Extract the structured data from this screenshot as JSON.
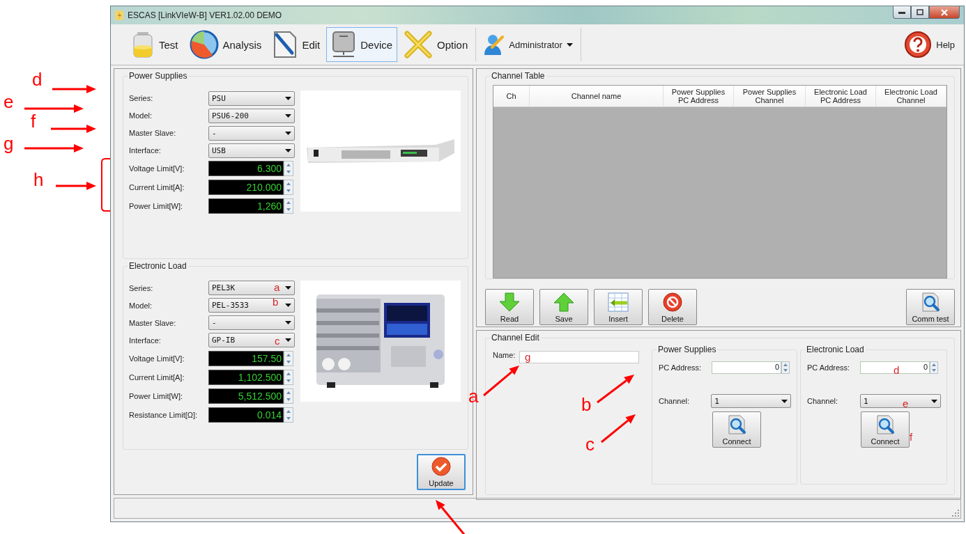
{
  "window": {
    "title": "ESCAS [LinkVIeW-B] VER1.02.00 DEMO"
  },
  "toolbar": {
    "items": [
      {
        "kind": "test",
        "label": "Test",
        "selected": false
      },
      {
        "kind": "analysis",
        "label": "Analysis",
        "selected": false
      },
      {
        "kind": "edit",
        "label": "Edit",
        "selected": false
      },
      {
        "kind": "device",
        "label": "Device",
        "selected": true
      },
      {
        "kind": "option",
        "label": "Option",
        "selected": false
      }
    ],
    "user": "Administrator",
    "help": "Help"
  },
  "power_supplies": {
    "title": "Power Supplies",
    "fields": [
      {
        "kind": "select",
        "label": "Series:",
        "value": "PSU"
      },
      {
        "kind": "select",
        "label": "Model:",
        "value": "PSU6-200"
      },
      {
        "kind": "select",
        "label": "Master Slave:",
        "value": "-"
      },
      {
        "kind": "select",
        "label": "Interface:",
        "value": "USB"
      },
      {
        "kind": "spin",
        "label": "Voltage Limit[V]:",
        "value": "6.300"
      },
      {
        "kind": "spin",
        "label": "Current Limit[A]:",
        "value": "210.000"
      },
      {
        "kind": "spin",
        "label": "Power Limit[W]:",
        "value": "1,260"
      }
    ]
  },
  "electronic_load": {
    "title": "Electronic Load",
    "fields": [
      {
        "kind": "select",
        "label": "Series:",
        "value": "PEL3K"
      },
      {
        "kind": "select",
        "label": "Model:",
        "value": "PEL-3533"
      },
      {
        "kind": "select",
        "label": "Master Slave:",
        "value": "-"
      },
      {
        "kind": "select",
        "label": "Interface:",
        "value": "GP-IB"
      },
      {
        "kind": "spin",
        "label": "Voltage Limit[V]:",
        "value": "157.50"
      },
      {
        "kind": "spin",
        "label": "Current Limit[A]:",
        "value": "1,102.500"
      },
      {
        "kind": "spin",
        "label": "Power Limit[W]:",
        "value": "5,512.500"
      },
      {
        "kind": "spin",
        "label": "Resistance Limit[Ω]:",
        "value": "0.014"
      }
    ]
  },
  "update_button": "Update",
  "channel_table": {
    "title": "Channel Table",
    "columns": [
      "Ch",
      "Channel name",
      "Power Supplies\nPC Address",
      "Power Supplies\nChannel",
      "Electronic Load\nPC Address",
      "Electronic Load\nChannel"
    ]
  },
  "table_buttons": [
    {
      "kind": "read",
      "label": "Read"
    },
    {
      "kind": "save",
      "label": "Save"
    },
    {
      "kind": "insert",
      "label": "Insert"
    },
    {
      "kind": "delete",
      "label": "Delete"
    },
    {
      "kind": "comm",
      "label": "Comm test"
    }
  ],
  "channel_edit": {
    "title": "Channel Edit",
    "name_label": "Name:",
    "groups": [
      {
        "title": "Power Supplies",
        "pc_address_label": "PC Address:",
        "pc_address": "0",
        "channel_label": "Channel:",
        "channel": "1",
        "connect": "Connect"
      },
      {
        "title": "Electronic Load",
        "pc_address_label": "PC Address:",
        "pc_address": "0",
        "channel_label": "Channel:",
        "channel": "1",
        "connect": "Connect"
      }
    ]
  },
  "annotations": [
    {
      "kind": "large",
      "text": "d"
    },
    {
      "kind": "large",
      "text": "e"
    },
    {
      "kind": "large",
      "text": "f"
    },
    {
      "kind": "large",
      "text": "g"
    },
    {
      "kind": "large",
      "text": "h"
    },
    {
      "kind": "large",
      "text": "a"
    },
    {
      "kind": "large",
      "text": "b"
    },
    {
      "kind": "large",
      "text": "c"
    },
    {
      "kind": "small",
      "text": "a"
    },
    {
      "kind": "small",
      "text": "b"
    },
    {
      "kind": "small",
      "text": "c"
    },
    {
      "kind": "small",
      "text": "g"
    },
    {
      "kind": "small",
      "text": "d"
    },
    {
      "kind": "small",
      "text": "e"
    },
    {
      "kind": "small",
      "text": "f"
    }
  ]
}
